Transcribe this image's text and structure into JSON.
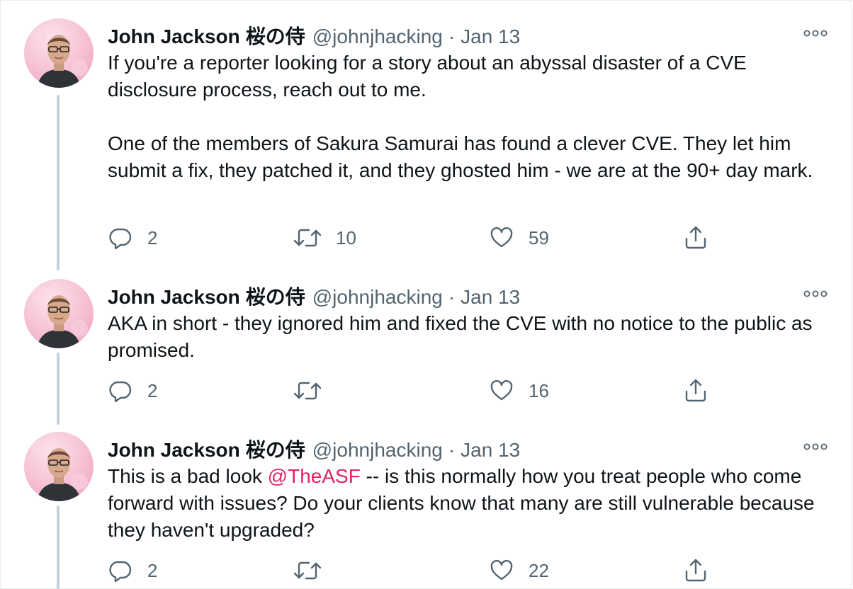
{
  "tweets": [
    {
      "author_name": "John Jackson",
      "author_name_jp": "桜の侍",
      "handle": "@johnjhacking",
      "separator": "·",
      "date": "Jan 13",
      "paragraphs": [
        "If you're a reporter looking for a story about an abyssal disaster of a CVE disclosure process, reach out to me.",
        "One of the members of Sakura Samurai has found a clever CVE. They let him submit a fix, they patched it, and they ghosted him - we are at the 90+ day mark."
      ],
      "reply_count": "2",
      "retweet_count": "10",
      "like_count": "59"
    },
    {
      "author_name": "John Jackson",
      "author_name_jp": "桜の侍",
      "handle": "@johnjhacking",
      "separator": "·",
      "date": "Jan 13",
      "text": "AKA in short - they ignored him and fixed the CVE with no notice to the public as promised.",
      "reply_count": "2",
      "retweet_count": "",
      "like_count": "16"
    },
    {
      "author_name": "John Jackson",
      "author_name_jp": "桜の侍",
      "handle": "@johnjhacking",
      "separator": "·",
      "date": "Jan 13",
      "text_before_mention": "This is a bad look ",
      "mention": "@TheASF",
      "text_after_mention": " -- is this normally how you treat people who come forward with issues? Do your clients know that many are still vulnerable because they haven't upgraded?",
      "reply_count": "2",
      "retweet_count": "",
      "like_count": "22"
    }
  ],
  "icons": {
    "reply": "reply-icon",
    "retweet": "retweet-icon",
    "like": "heart-icon",
    "share": "share-icon",
    "more": "more-icon"
  },
  "colors": {
    "text": "#0f1419",
    "secondary": "#536471",
    "mention": "#e0245e",
    "thread_line": "#c4cfd6",
    "avatar_bg": "#f6c9d8"
  }
}
